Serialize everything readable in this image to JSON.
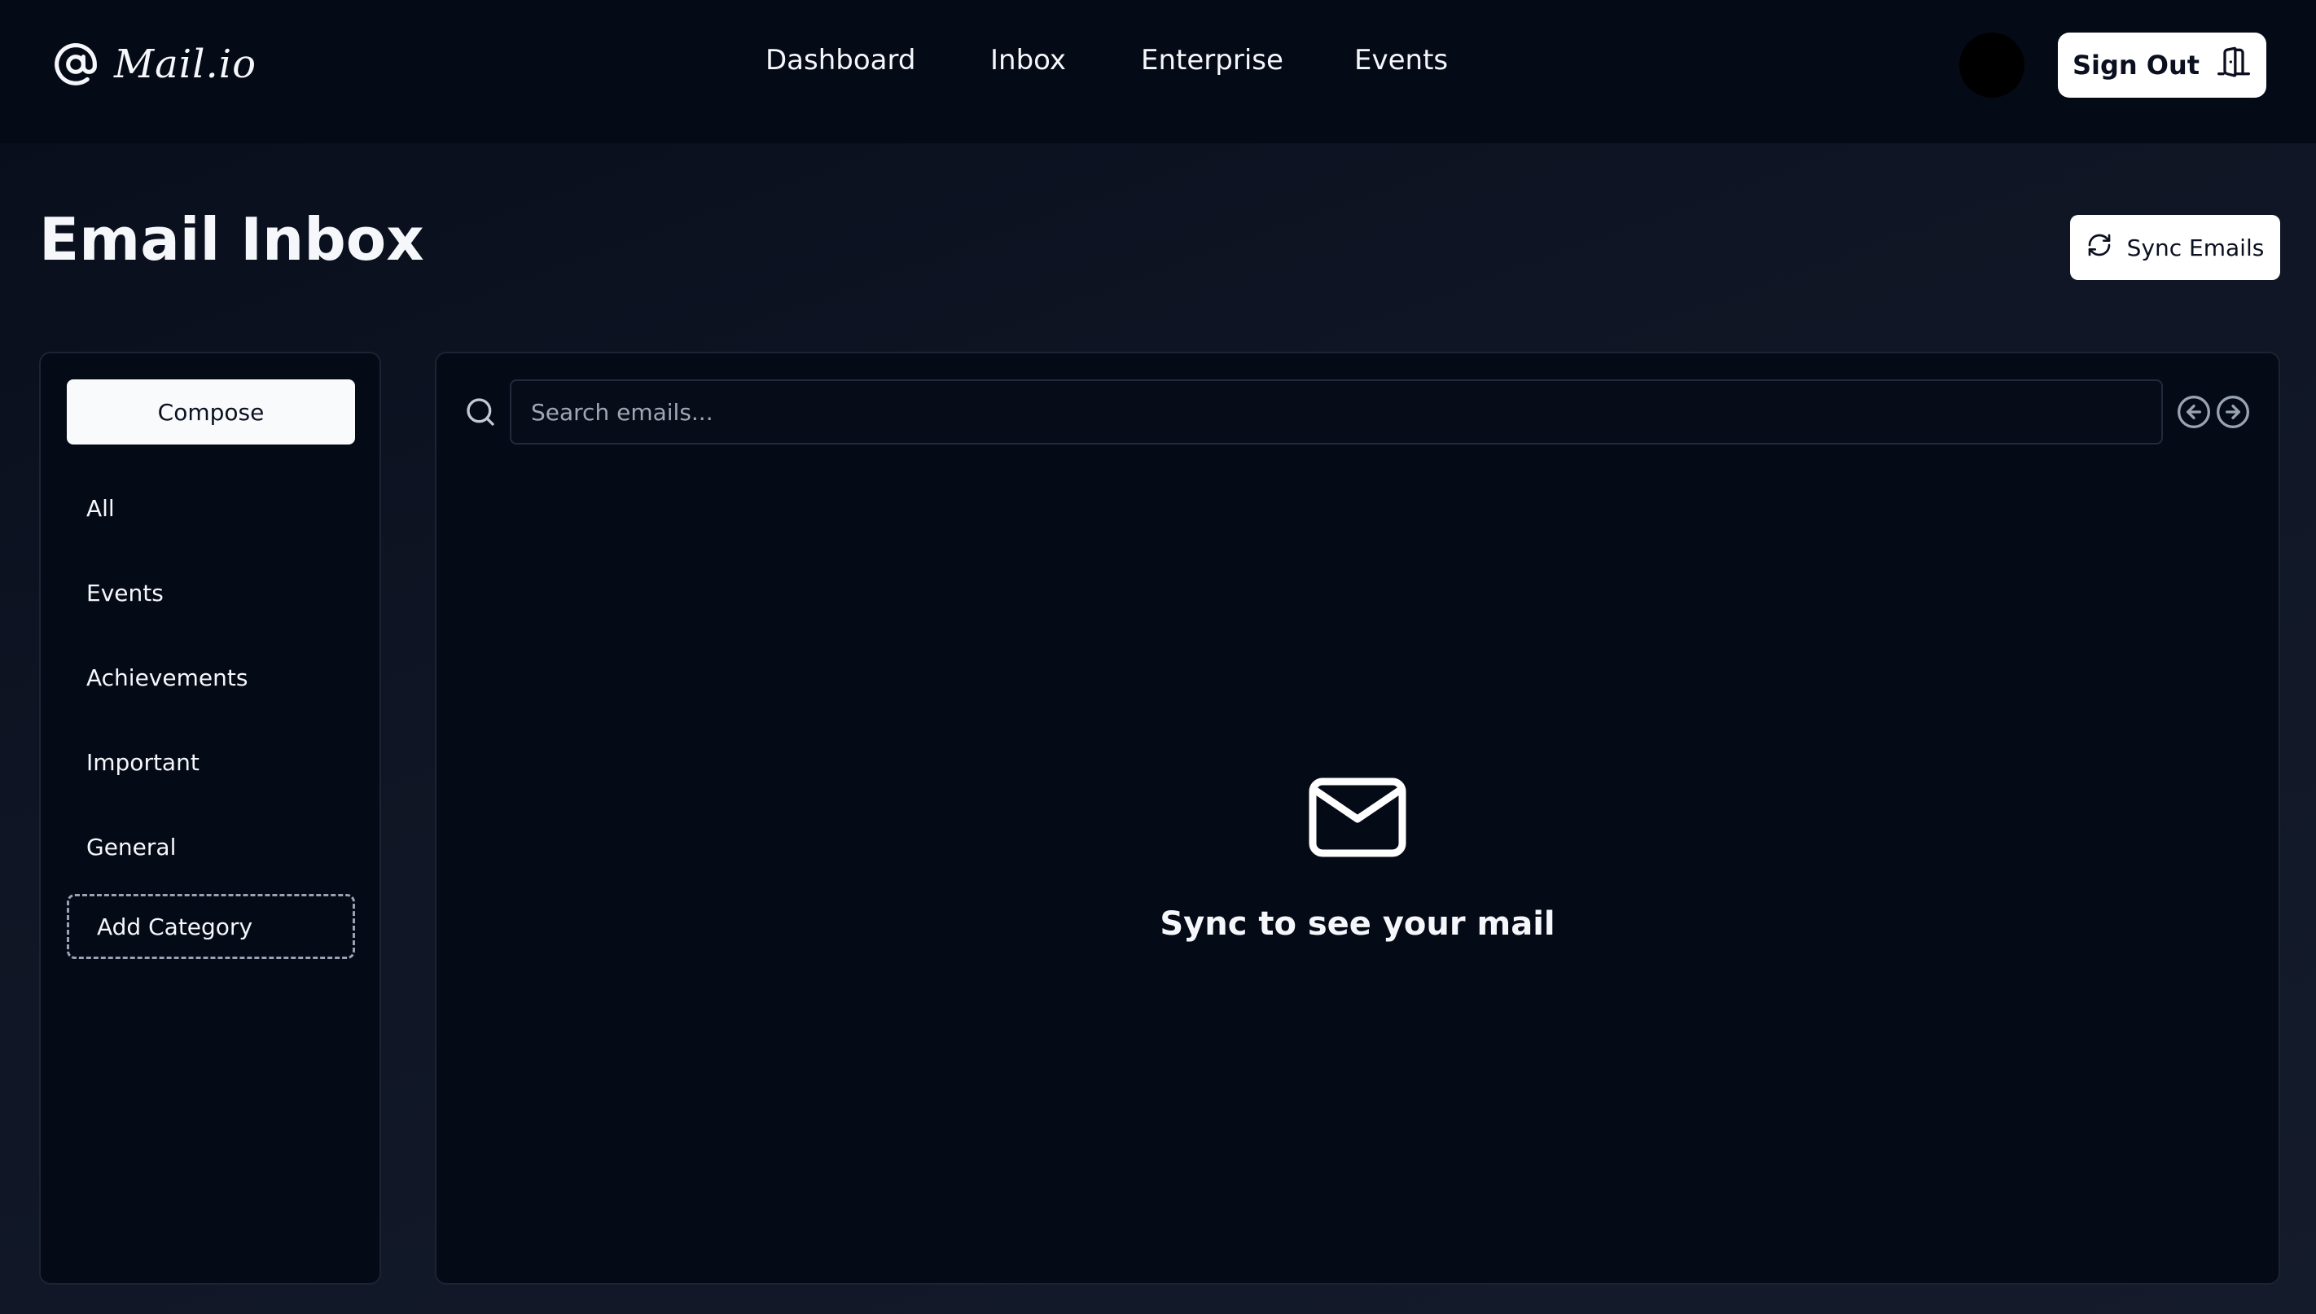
{
  "brand": {
    "name": "Mail.io",
    "icon": "at-sign-icon"
  },
  "nav": {
    "links": [
      "Dashboard",
      "Inbox",
      "Enterprise",
      "Events"
    ]
  },
  "header": {
    "signout_label": "Sign Out",
    "signout_icon": "door-exit-icon"
  },
  "page": {
    "title": "Email Inbox",
    "sync_label": "Sync Emails",
    "sync_icon": "refresh-icon"
  },
  "sidebar": {
    "compose_label": "Compose",
    "categories": [
      "All",
      "Events",
      "Achievements",
      "Important",
      "General"
    ],
    "add_category_label": "Add Category"
  },
  "main": {
    "search_placeholder": "Search emails...",
    "search_value": "",
    "empty_state_text": "Sync to see your mail",
    "empty_state_icon": "mail-icon"
  },
  "colors": {
    "background": "#0c1221",
    "panel": "#050a17",
    "border": "#1c2335",
    "button_bg": "#ffffff",
    "text": "#f5f7fa"
  }
}
